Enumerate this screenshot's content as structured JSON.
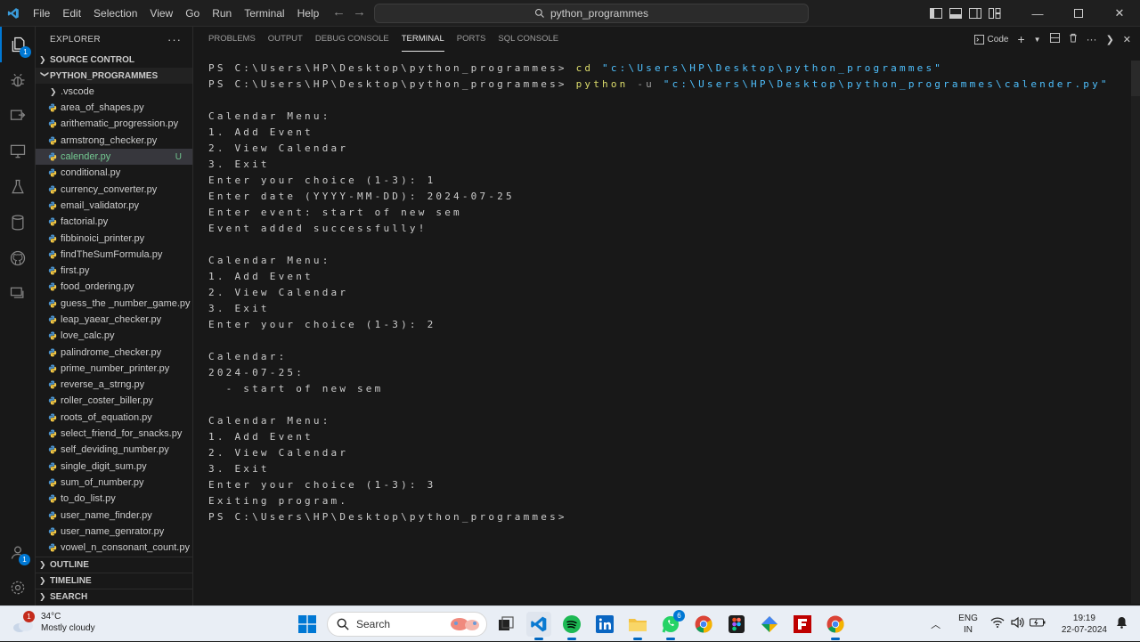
{
  "titlebar": {
    "menu": [
      "File",
      "Edit",
      "Selection",
      "View",
      "Go",
      "Run",
      "Terminal",
      "Help"
    ],
    "search_text": "python_programmes"
  },
  "activitybar": {
    "explorer_badge": "1",
    "accounts_badge": "1"
  },
  "sidebar": {
    "title": "EXPLORER",
    "sections": {
      "source_control": "SOURCE CONTROL",
      "project": "PYTHON_PROGRAMMES",
      "outline": "OUTLINE",
      "timeline": "TIMELINE",
      "search": "SEARCH"
    },
    "folder": ".vscode",
    "files": [
      {
        "name": "area_of_shapes.py",
        "status": ""
      },
      {
        "name": "arithematic_progression.py",
        "status": ""
      },
      {
        "name": "armstrong_checker.py",
        "status": ""
      },
      {
        "name": "calender.py",
        "status": "U"
      },
      {
        "name": "conditional.py",
        "status": ""
      },
      {
        "name": "currency_converter.py",
        "status": ""
      },
      {
        "name": "email_validator.py",
        "status": ""
      },
      {
        "name": "factorial.py",
        "status": ""
      },
      {
        "name": "fibbinoici_printer.py",
        "status": ""
      },
      {
        "name": "findTheSumFormula.py",
        "status": ""
      },
      {
        "name": "first.py",
        "status": ""
      },
      {
        "name": "food_ordering.py",
        "status": ""
      },
      {
        "name": "guess_the _number_game.py",
        "status": ""
      },
      {
        "name": "leap_yaear_checker.py",
        "status": ""
      },
      {
        "name": "love_calc.py",
        "status": ""
      },
      {
        "name": "palindrome_checker.py",
        "status": ""
      },
      {
        "name": "prime_number_printer.py",
        "status": ""
      },
      {
        "name": "reverse_a_strng.py",
        "status": ""
      },
      {
        "name": "roller_coster_biller.py",
        "status": ""
      },
      {
        "name": "roots_of_equation.py",
        "status": ""
      },
      {
        "name": "select_friend_for_snacks.py",
        "status": ""
      },
      {
        "name": "self_deviding_number.py",
        "status": ""
      },
      {
        "name": "single_digit_sum.py",
        "status": ""
      },
      {
        "name": "sum_of_number.py",
        "status": ""
      },
      {
        "name": "to_do_list.py",
        "status": ""
      },
      {
        "name": "user_name_finder.py",
        "status": ""
      },
      {
        "name": "user_name_genrator.py",
        "status": ""
      },
      {
        "name": "vowel_n_consonant_count.py",
        "status": ""
      }
    ]
  },
  "panel": {
    "tabs": [
      "PROBLEMS",
      "OUTPUT",
      "DEBUG CONSOLE",
      "TERMINAL",
      "PORTS",
      "SQL CONSOLE"
    ],
    "active_tab": "TERMINAL",
    "terminal_label": "Code"
  },
  "terminal": {
    "prompt": "PS C:\\Users\\HP\\Desktop\\python_programmes> ",
    "cmd1": {
      "cmd": "cd",
      "arg": " \"c:\\Users\\HP\\Desktop\\python_programmes\""
    },
    "cmd2": {
      "cmd": "python",
      "flag": " -u",
      "arg": " \"c:\\Users\\HP\\Desktop\\python_programmes\\calender.py\""
    },
    "output": [
      "",
      "Calendar Menu:",
      "1. Add Event",
      "2. View Calendar",
      "3. Exit",
      "Enter your choice (1-3): 1",
      "Enter date (YYYY-MM-DD): 2024-07-25",
      "Enter event: start of new sem",
      "Event added successfully!",
      "",
      "Calendar Menu:",
      "1. Add Event",
      "2. View Calendar",
      "3. Exit",
      "Enter your choice (1-3): 2",
      "",
      "Calendar:",
      "2024-07-25:",
      "  - start of new sem",
      "",
      "Calendar Menu:",
      "1. Add Event",
      "2. View Calendar",
      "3. Exit",
      "Enter your choice (1-3): 3",
      "Exiting program.",
      "PS C:\\Users\\HP\\Desktop\\python_programmes> "
    ]
  },
  "taskbar": {
    "weather_temp": "34°C",
    "weather_desc": "Mostly cloudy",
    "weather_badge": "1",
    "search_label": "Search",
    "whatsapp_badge": "6",
    "lang_1": "ENG",
    "lang_2": "IN",
    "time": "19:19",
    "date": "22-07-2024"
  },
  "colors": {
    "accent": "#0078d4",
    "untracked": "#73c991",
    "terminal_cmd": "#dcdc6b",
    "terminal_string": "#4fc1ff"
  }
}
